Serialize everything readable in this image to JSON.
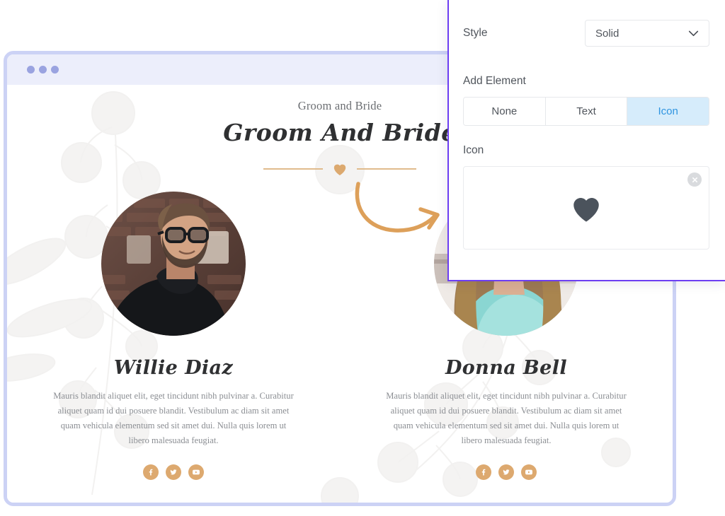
{
  "browser": {
    "window_dots": 3
  },
  "site": {
    "eyebrow": "Groom and Bride",
    "headline": "Groom And Bride",
    "divider_icon": "heart-icon",
    "divider_color": "#dca96f",
    "people": [
      {
        "photo_alt": "man-with-glasses-black-turtleneck",
        "name": "Willie Diaz",
        "description": "Mauris blandit aliquet elit, eget tincidunt nibh pulvinar a. Curabitur aliquet quam id dui posuere blandit. Vestibulum ac diam sit amet quam vehicula elementum sed sit amet dui. Nulla quis lorem ut libero malesuada feugiat.",
        "socials": [
          "facebook-icon",
          "twitter-icon",
          "youtube-icon"
        ]
      },
      {
        "photo_alt": "smiling-woman-teal-top",
        "name": "Donna Bell",
        "description": "Mauris blandit aliquet elit, eget tincidunt nibh pulvinar a. Curabitur aliquet quam id dui posuere blandit. Vestibulum ac diam sit amet quam vehicula elementum sed sit amet dui. Nulla quis lorem ut libero malesuada feugiat.",
        "socials": [
          "facebook-icon",
          "twitter-icon",
          "youtube-icon"
        ]
      }
    ],
    "social_color": "#dda96f"
  },
  "panel": {
    "border_color": "#6d3ef2",
    "style_label": "Style",
    "style_value": "Solid",
    "style_options": [
      "Solid"
    ],
    "add_element_label": "Add Element",
    "segments": [
      {
        "label": "None",
        "active": false
      },
      {
        "label": "Text",
        "active": false
      },
      {
        "label": "Icon",
        "active": true
      }
    ],
    "active_color": "#2e94e0",
    "active_bg": "#d6ecfb",
    "icon_label": "Icon",
    "icon_preview": "heart-icon",
    "icon_preview_color": "#4b535c",
    "clear_icon": "close-circle-icon"
  },
  "annotation": {
    "arrow": "curved-arrow-right",
    "arrow_color": "#dda05a"
  }
}
